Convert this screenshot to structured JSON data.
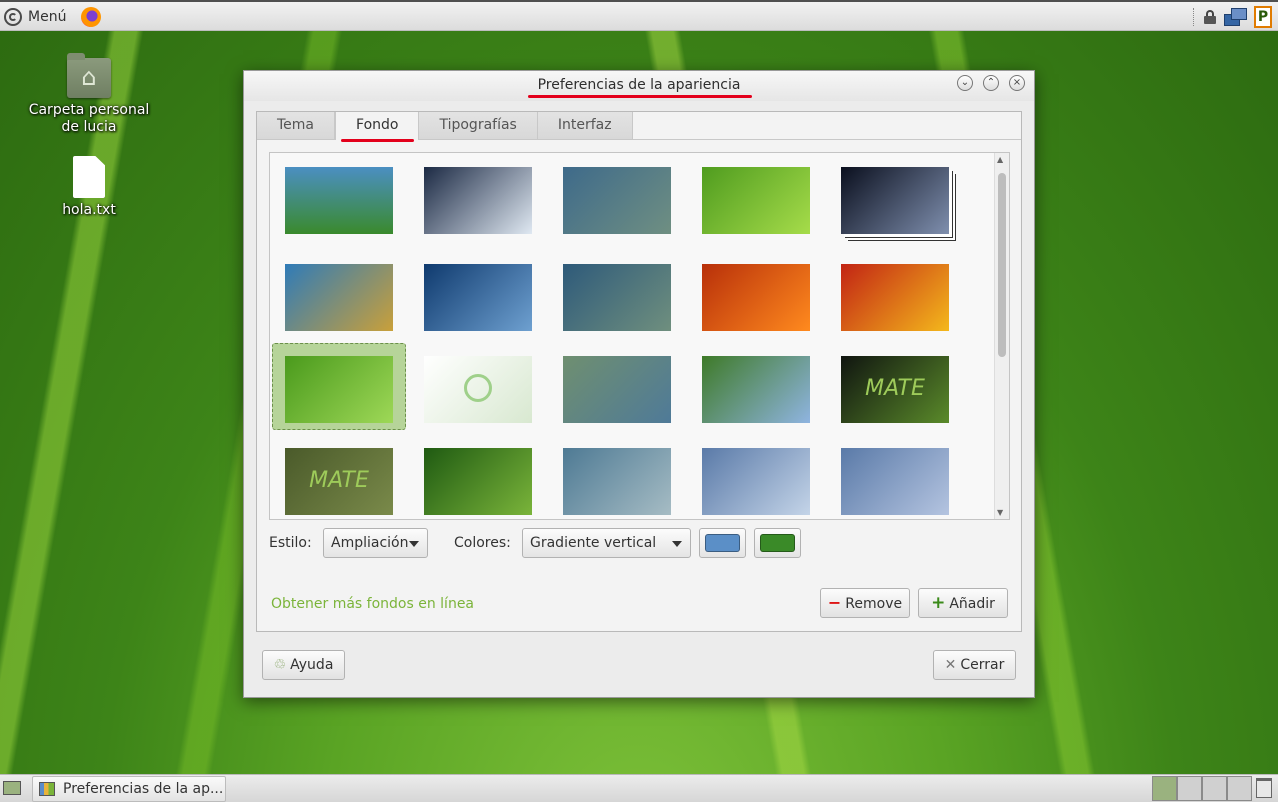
{
  "top_panel": {
    "menu_label": "Menú",
    "menu_icon": "mint-logo-icon",
    "launcher_icon": "firefox-icon",
    "tray_icons": [
      "lock-icon",
      "network-icon",
      "p-applet-icon"
    ],
    "p_label": "P"
  },
  "desktop": {
    "icons": [
      {
        "label": "Carpeta personal de lucia",
        "icon": "home-folder-icon"
      },
      {
        "label": "hola.txt",
        "icon": "text-file-icon"
      }
    ]
  },
  "window": {
    "title": "Preferencias de la apariencia",
    "controls": [
      "minimize",
      "maximize",
      "close"
    ],
    "tabs": [
      {
        "label": "Tema",
        "active": false
      },
      {
        "label": "Fondo",
        "active": true
      },
      {
        "label": "Tipografías",
        "active": false
      },
      {
        "label": "Interfaz",
        "active": false
      }
    ],
    "gallery": {
      "selected_index": 10,
      "thumbnails": [
        {
          "name": "green-blue-gradient",
          "colors": [
            "#4b8fc2",
            "#3a8a2c"
          ]
        },
        {
          "name": "water-drop",
          "colors": [
            "#1c2a44",
            "#dfe8f2"
          ]
        },
        {
          "name": "blue-gray-waves",
          "colors": [
            "#3e6a8a",
            "#6f8f82"
          ]
        },
        {
          "name": "green-leaf",
          "colors": [
            "#4f9c1f",
            "#a6dc4a"
          ]
        },
        {
          "name": "earth-from-space",
          "colors": [
            "#0a0f1e",
            "#7f8fae"
          ]
        },
        {
          "name": "beach-grass",
          "colors": [
            "#2f7bb8",
            "#c9a03a"
          ]
        },
        {
          "name": "blue-bubbles",
          "colors": [
            "#0f3a6e",
            "#6ea0d0"
          ]
        },
        {
          "name": "teal-bubbles",
          "colors": [
            "#2e5a7a",
            "#6f8f7e"
          ]
        },
        {
          "name": "orange-flower",
          "colors": [
            "#b8300a",
            "#ff8a1e"
          ]
        },
        {
          "name": "red-marigold",
          "colors": [
            "#c22414",
            "#f4b81c"
          ]
        },
        {
          "name": "green-grass",
          "colors": [
            "#4a9a1c",
            "#9ed857"
          ]
        },
        {
          "name": "mint-logo-white",
          "colors": [
            "#ffffff",
            "#d8e8d0"
          ]
        },
        {
          "name": "blue-green-lace",
          "colors": [
            "#6f8f70",
            "#4f7a98"
          ]
        },
        {
          "name": "ladybug-flowers",
          "colors": [
            "#3e7a28",
            "#8fb4e0"
          ]
        },
        {
          "name": "mate-logo-dark",
          "colors": [
            "#101510",
            "#5a8a2a"
          ]
        },
        {
          "name": "mate-logo-olive",
          "colors": [
            "#4a5a2a",
            "#7a8a4a"
          ]
        },
        {
          "name": "green-leaves-drops",
          "colors": [
            "#1f5a12",
            "#7ab43a"
          ]
        },
        {
          "name": "blue-gray-wave-2",
          "colors": [
            "#4e7a94",
            "#a6bcc4"
          ]
        },
        {
          "name": "blue-abstract-1",
          "colors": [
            "#5a7aa8",
            "#c4d4e8"
          ]
        },
        {
          "name": "blue-abstract-2",
          "colors": [
            "#5a7aa8",
            "#b4c4e0"
          ]
        }
      ],
      "mate_text": "MATE"
    },
    "style_label": "Estilo:",
    "style_value": "Ampliación",
    "colors_label": "Colores:",
    "colors_value": "Gradiente vertical",
    "primary_color": "#5b8fc7",
    "secondary_color": "#3a8a28",
    "link_text": "Obtener más fondos en línea",
    "remove_label": "Remove",
    "add_label": "Añadir",
    "help_label": "Ayuda",
    "close_label": "Cerrar"
  },
  "bottom_panel": {
    "task_label": "Preferencias de la ap...",
    "workspaces": 4,
    "active_workspace": 1
  },
  "accents": {
    "annotation_red": "#e3001b",
    "link_green": "#7bb43a"
  }
}
